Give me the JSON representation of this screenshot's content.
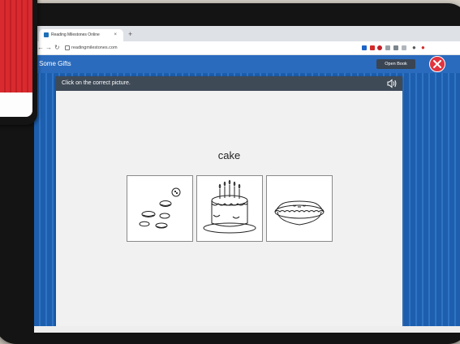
{
  "browser": {
    "tab_title": "Reading Milestones Online",
    "tab_close": "×",
    "new_tab": "+",
    "url": "readingmilestones.com",
    "nav": {
      "back": "←",
      "forward": "→",
      "reload": "↻"
    }
  },
  "app": {
    "title": "Some Gifts",
    "open_book_label": "Open Book",
    "close_icon": "close-icon"
  },
  "activity": {
    "instruction": "Click on the correct picture.",
    "word": "cake",
    "choices": [
      {
        "name": "cookies",
        "icon": "cookies-picture"
      },
      {
        "name": "cake",
        "icon": "birthday-cake-picture"
      },
      {
        "name": "pie",
        "icon": "pie-picture"
      }
    ]
  },
  "colors": {
    "header_blue": "#2a6bbd",
    "stripe_blue": "#1d5fae",
    "instruction_bar": "#3f4a57",
    "close_red": "#e1343f"
  }
}
